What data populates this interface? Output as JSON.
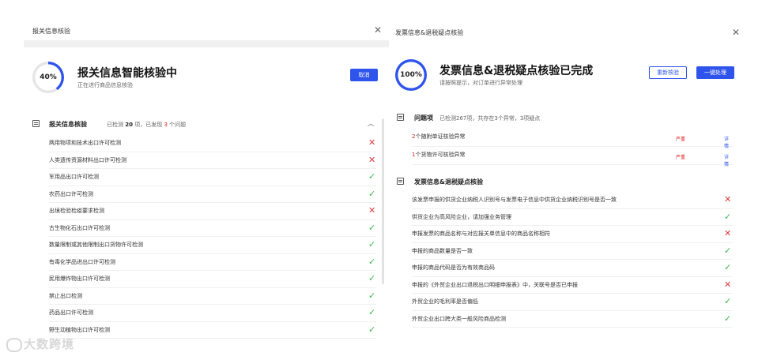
{
  "left": {
    "window_title": "报关信息核验",
    "progress_label": "40%",
    "progress_value": 40,
    "main_title": "报关信息智能核验中",
    "subtitle": "正在进行商品信息核验",
    "cancel_label": "取消",
    "section_title": "报关信息核验",
    "meta_prefix": "已检测",
    "meta_count": "20",
    "meta_mid": "项，已发现",
    "meta_issues": "3",
    "meta_suffix": "个问题",
    "items": [
      {
        "label": "两用物项和技术出口许可检测",
        "status": "fail"
      },
      {
        "label": "人类遗传资源材料出口许可检测",
        "status": "fail"
      },
      {
        "label": "军用品出口许可检测",
        "status": "pass"
      },
      {
        "label": "农药出口许可检测",
        "status": "pass"
      },
      {
        "label": "出境检验检疫要求检测",
        "status": "fail"
      },
      {
        "label": "古生物化石出口许可检测",
        "status": "pass"
      },
      {
        "label": "数量限制或其他限制出口货物许可检测",
        "status": "pass"
      },
      {
        "label": "有毒化学品进出口许可检测",
        "status": "pass"
      },
      {
        "label": "民用爆炸物出口许可检测",
        "status": "pass"
      },
      {
        "label": "禁止出口检测",
        "status": "pass"
      },
      {
        "label": "药品出口许可检测",
        "status": "pass"
      },
      {
        "label": "野生动植物出口许可检测",
        "status": "pass"
      }
    ]
  },
  "right": {
    "window_title": "发票信息&退税疑点核验",
    "progress_label": "100%",
    "progress_value": 100,
    "main_title": "发票信息&退税疑点核验已完成",
    "subtitle": "请按照提示，对订单进行异常处理",
    "recheck_label": "重新核验",
    "oneclick_label": "一键处理",
    "problems_title": "问题项",
    "problems_meta": "已检测267项，共存在3个异常，3项疑点",
    "problems": [
      {
        "count": "2",
        "text": "个随附单证核验异常",
        "severity": "严重",
        "action": "详情"
      },
      {
        "count": "1",
        "text": "个货物许可核验异常",
        "severity": "严重",
        "action": "详情"
      }
    ],
    "section_title": "发票信息&退税疑点核验",
    "items": [
      {
        "label": "该发票申报的供货企业纳税人识别号与发票电子信息中供货企业纳税识别号是否一致",
        "status": "fail"
      },
      {
        "label": "供货企业为高风险企业，请加强业务管理",
        "status": "pass"
      },
      {
        "label": "申报发票的商品名称与对应报关单信息中的商品名称相符",
        "status": "fail"
      },
      {
        "label": "申报的商品数量是否一致",
        "status": "pass"
      },
      {
        "label": "申报的商品代码是否为有效商品码",
        "status": "pass"
      },
      {
        "label": "申报的《外贸企业出口退税出口明细申报表》中，关联号是否已申报",
        "status": "fail"
      },
      {
        "label": "外贸企业的毛利率是否偏低",
        "status": "pass"
      },
      {
        "label": "外贸企业出口跨大类一般风险商品检测",
        "status": "pass"
      }
    ]
  },
  "symbols": {
    "close": "✕",
    "fail": "✕",
    "pass": "✓",
    "collapse": "︿"
  },
  "watermark": "大数跨境",
  "colors": {
    "accent": "#2f54eb",
    "danger": "#e0393e",
    "success": "#3ab54a"
  }
}
